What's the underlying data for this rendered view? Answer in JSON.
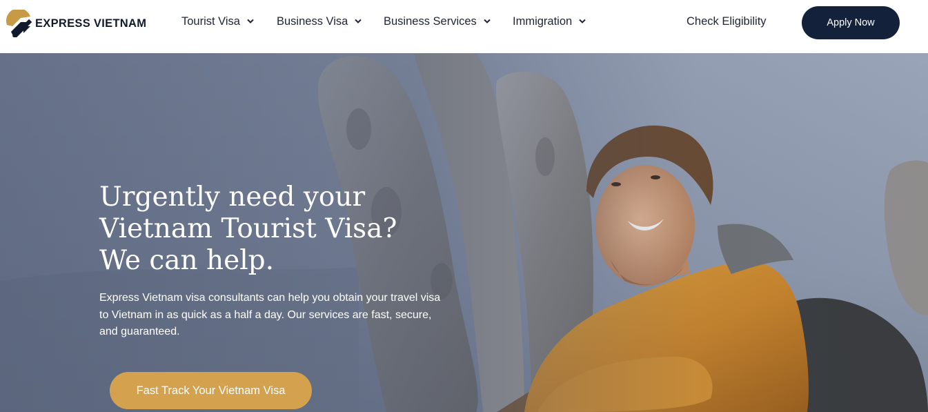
{
  "header": {
    "logo_text": "EXPRESS VIETNAM",
    "logo_icon": "express-vietnam-logo-mark",
    "nav": [
      {
        "label": "Tourist Visa",
        "icon": "chevron-down-icon"
      },
      {
        "label": "Business Visa",
        "icon": "chevron-down-icon"
      },
      {
        "label": "Business Services",
        "icon": "chevron-down-icon"
      },
      {
        "label": "Immigration",
        "icon": "chevron-down-icon"
      }
    ],
    "check_eligibility": "Check Eligibility",
    "apply_now": "Apply Now"
  },
  "hero": {
    "headline": [
      "Urgently need your",
      "Vietnam Tourist Visa?",
      "We can help."
    ],
    "lead": "Express Vietnam visa consultants can help you obtain your travel visa to Vietnam in as quick as a half a day. Our services are fast, secure, and guaranteed.",
    "cta": "Fast Track Your Vietnam Visa"
  },
  "colors": {
    "navy": "#13213a",
    "gold": "#d4a24e",
    "text_dark": "#1d2433",
    "white": "#ffffff"
  }
}
